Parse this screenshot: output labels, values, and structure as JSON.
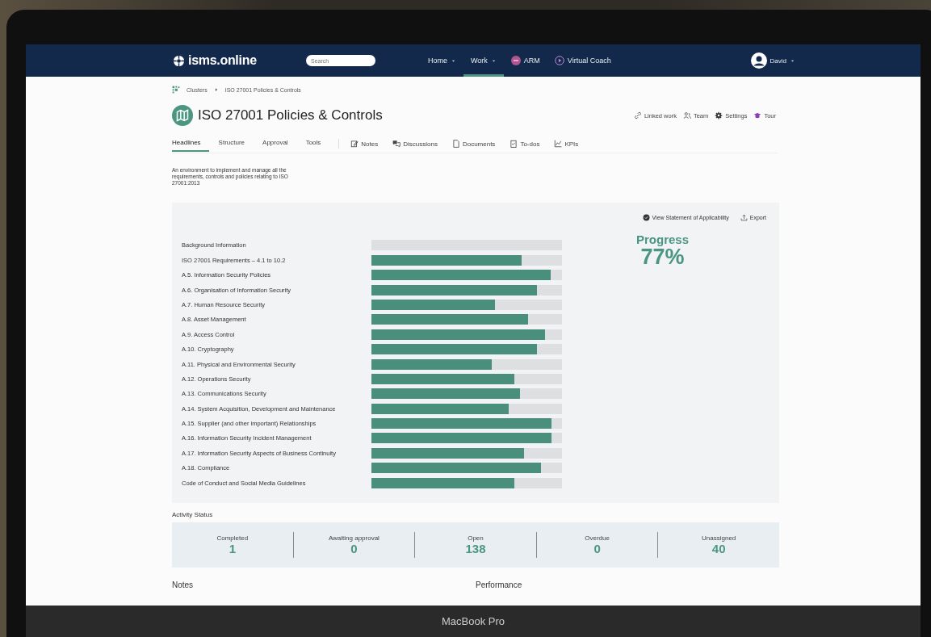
{
  "device_label": "MacBook Pro",
  "navbar": {
    "logo": "isms.online",
    "search": {
      "placeholder": "Search"
    },
    "items": [
      {
        "kind": "menu",
        "label": "Home",
        "selected": false
      },
      {
        "kind": "menu",
        "label": "Work",
        "selected": true
      },
      {
        "kind": "badge",
        "label": "ARM",
        "selected": false
      },
      {
        "kind": "play",
        "label": "Virtual Coach",
        "selected": false
      }
    ],
    "user": "David"
  },
  "breadcrumb": [
    "Clusters",
    "ISO 27001 Policies & Controls"
  ],
  "title": "ISO 27001 Policies & Controls",
  "actions": [
    {
      "kind": "link",
      "label": "Linked work"
    },
    {
      "kind": "team",
      "label": "Team"
    },
    {
      "kind": "gear",
      "label": "Settings"
    },
    {
      "kind": "tour",
      "label": "Tour"
    }
  ],
  "tabs": [
    {
      "label": "Headlines",
      "selected": true
    },
    {
      "label": "Structure",
      "selected": false
    },
    {
      "label": "Approval",
      "selected": false
    },
    {
      "label": "Tools",
      "selected": false
    }
  ],
  "tools": [
    {
      "kind": "notes",
      "label": "Notes"
    },
    {
      "kind": "discussions",
      "label": "Discussions"
    },
    {
      "kind": "documents",
      "label": "Documents"
    },
    {
      "kind": "todos",
      "label": "To-dos"
    },
    {
      "kind": "kpis",
      "label": "KPIs"
    }
  ],
  "description": "An environment to implement and manage all the requirements, controls and policies relating to ISO 27001:2013",
  "panel": {
    "links": [
      {
        "kind": "check",
        "label": "View Statement of Applicability"
      },
      {
        "kind": "export",
        "label": "Export"
      }
    ],
    "progress_label": "Progress",
    "progress_value": "77%",
    "rows": [
      {
        "name": "Background Information",
        "level": 0
      },
      {
        "name": "ISO 27001 Requirements – 4.1 to 10.2",
        "level": 0.79
      },
      {
        "name": "A.5. Information Security Policies",
        "level": 0.94
      },
      {
        "name": "A.6. Organisation of Information Security",
        "level": 0.87
      },
      {
        "name": "A.7. Human Resource Security",
        "level": 0.65
      },
      {
        "name": "A.8. Asset Management",
        "level": 0.82
      },
      {
        "name": "A.9. Access Control",
        "level": 0.91
      },
      {
        "name": "A.10. Cryptography",
        "level": 0.87
      },
      {
        "name": "A.11. Physical and Environmental Security",
        "level": 0.63
      },
      {
        "name": "A.12. Operations Security",
        "level": 0.75
      },
      {
        "name": "A.13. Communications Security",
        "level": 0.78
      },
      {
        "name": "A.14. System Acquisition, Development and Maintenance",
        "level": 0.72
      },
      {
        "name": "A.15. Supplier (and other important) Relationships",
        "level": 0.945
      },
      {
        "name": "A.16. Information Security Incident Management",
        "level": 0.945
      },
      {
        "name": "A.17. Information Security Aspects of Business Continuity",
        "level": 0.8
      },
      {
        "name": "A.18. Compliance",
        "level": 0.89
      },
      {
        "name": "Code of Conduct and Social Media Guidelines",
        "level": 0.75
      }
    ]
  },
  "activity": {
    "title": "Activity Status",
    "stats": [
      {
        "label": "Completed",
        "value": "1"
      },
      {
        "label": "Awaiting approval",
        "value": "0"
      },
      {
        "label": "Open",
        "value": "138"
      },
      {
        "label": "Overdue",
        "value": "0"
      },
      {
        "label": "Unassigned",
        "value": "40"
      }
    ]
  },
  "sections": [
    "Notes",
    "Performance"
  ]
}
